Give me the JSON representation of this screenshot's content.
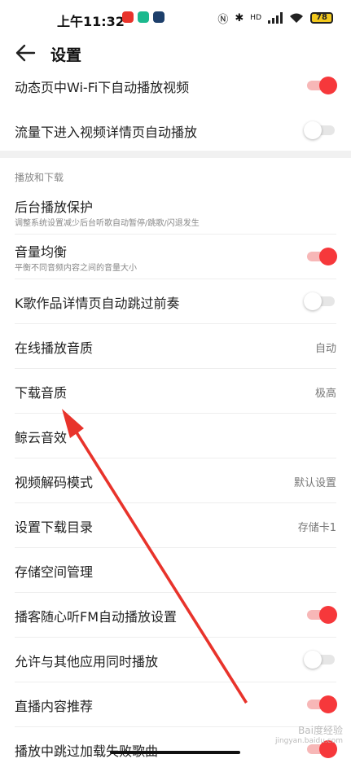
{
  "status_bar": {
    "time": "上午11:32",
    "battery": "78",
    "network": "HD"
  },
  "header": {
    "title": "设置"
  },
  "rows_top": [
    {
      "label": "动态页中Wi-Fi下自动播放视频",
      "toggle": true
    },
    {
      "label": "流量下进入视频详情页自动播放",
      "toggle": false
    }
  ],
  "section": {
    "title": "播放和下载"
  },
  "rows": [
    {
      "label": "后台播放保护",
      "sub": "调整系统设置减少后台听歌自动暂停/跳歌/闪退发生"
    },
    {
      "label": "音量均衡",
      "sub": "平衡不同音频内容之间的音量大小",
      "toggle": true
    },
    {
      "label": "K歌作品详情页自动跳过前奏",
      "toggle": false
    },
    {
      "label": "在线播放音质",
      "value": "自动"
    },
    {
      "label": "下载音质",
      "value": "极高"
    },
    {
      "label": "鲸云音效"
    },
    {
      "label": "视频解码模式",
      "value": "默认设置"
    },
    {
      "label": "设置下载目录",
      "value": "存储卡1"
    },
    {
      "label": "存储空间管理"
    },
    {
      "label": "播客随心听FM自动播放设置",
      "toggle": true
    },
    {
      "label": "允许与其他应用同时播放",
      "toggle": false
    },
    {
      "label": "直播内容推荐",
      "toggle": true
    },
    {
      "label": "播放中跳过加载失败歌曲",
      "toggle": true
    }
  ],
  "watermark": {
    "line1": "Bai度经验",
    "line2": "jingyan.baidu.com"
  },
  "colors": {
    "accent": "#f6383b",
    "annotation_arrow": "#e8332b"
  }
}
